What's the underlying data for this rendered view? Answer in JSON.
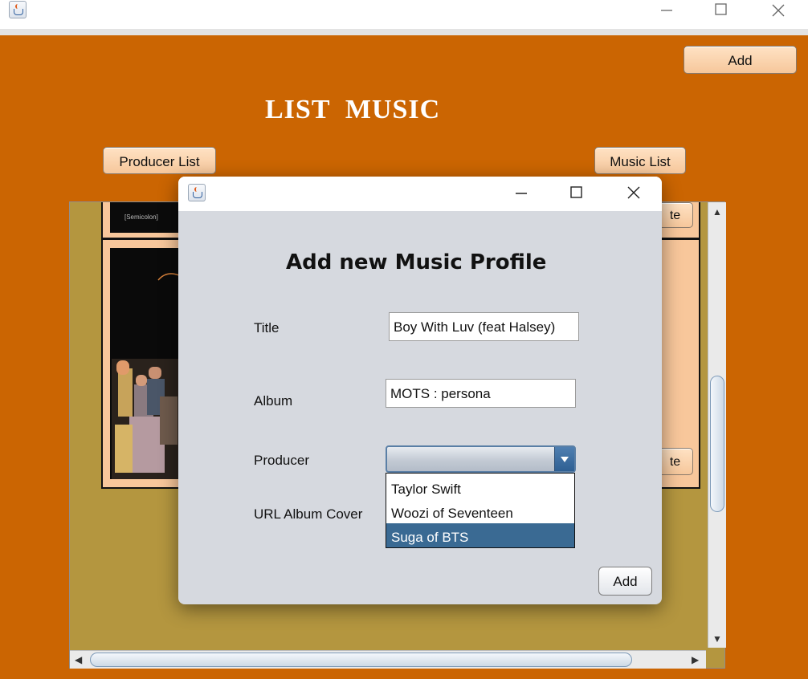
{
  "main_window": {
    "controls": {
      "minimize": "—",
      "maximize": "☐",
      "close": "✕"
    }
  },
  "main": {
    "add_button": "Add",
    "title": "LIST  MUSIC",
    "producer_list_button": "Producer List",
    "music_list_button": "Music List",
    "card_button_fragment_1": "te",
    "card_button_fragment_2": "te",
    "cover_caption": "[Semicolon]"
  },
  "dialog": {
    "heading": "Add new Music Profile",
    "labels": {
      "title": "Title",
      "album": "Album",
      "producer": "Producer",
      "url_album_cover": "URL Album Cover"
    },
    "fields": {
      "title_value": "Boy With Luv (feat Halsey)",
      "album_value": "MOTS : persona",
      "producer_value": ""
    },
    "producer_options": [
      "Taylor Swift",
      "Woozi of Seventeen",
      "Suga of BTS"
    ],
    "selected_option": "Suga of BTS",
    "add_button": "Add"
  },
  "colors": {
    "background": "#cb6502",
    "button": "#f8c79b",
    "selection": "#3a6a93",
    "scroll_panel": "#b4963f"
  }
}
